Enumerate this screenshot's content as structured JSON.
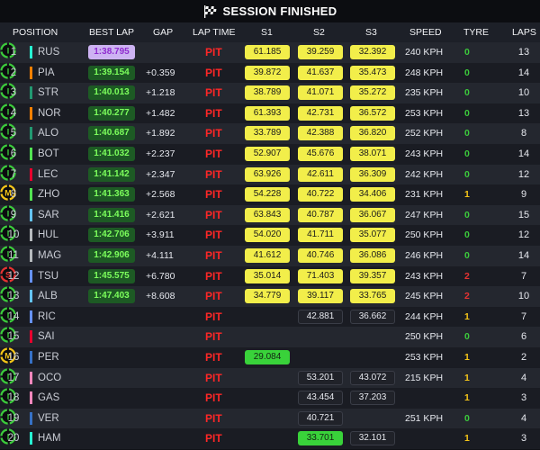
{
  "title": "SESSION FINISHED",
  "colors": {
    "purple_box": "#cdb3f2",
    "green_box": "#1d5a24",
    "sector_yellow": "#f2ee4a",
    "sector_green": "#39d23a",
    "pit_red": "#ff2727",
    "tyre_intermediate": "#3ccb3c",
    "tyre_medium": "#f5c518",
    "tyre_soft": "#e63232"
  },
  "headers": {
    "position": "POSITION",
    "best_lap": "BEST LAP",
    "gap": "GAP",
    "lap_time": "LAP TIME",
    "s1": "S1",
    "s2": "S2",
    "s3": "S3",
    "speed": "SPEED",
    "tyre": "TYRE",
    "laps": "LAPS"
  },
  "rows": [
    {
      "pos": "1",
      "driver": "RUS",
      "team_color": "#27f4d2",
      "best": "1:38.795",
      "best_style": "purple",
      "gap": "",
      "lap_time": "PIT",
      "s1": "61.185",
      "s1_style": "yellow",
      "s2": "39.259",
      "s2_style": "yellow",
      "s3": "32.392",
      "s3_style": "yellow",
      "speed": "240 KPH",
      "stint": "0",
      "tyre": "I",
      "tyre_color": "#3ccb3c",
      "laps": "13"
    },
    {
      "pos": "2",
      "driver": "PIA",
      "team_color": "#ff8000",
      "best": "1:39.154",
      "best_style": "green",
      "gap": "+0.359",
      "lap_time": "PIT",
      "s1": "39.872",
      "s1_style": "yellow",
      "s2": "41.637",
      "s2_style": "yellow",
      "s3": "35.473",
      "s3_style": "yellow",
      "speed": "248 KPH",
      "stint": "0",
      "tyre": "I",
      "tyre_color": "#3ccb3c",
      "laps": "14"
    },
    {
      "pos": "3",
      "driver": "STR",
      "team_color": "#229971",
      "best": "1:40.013",
      "best_style": "green",
      "gap": "+1.218",
      "lap_time": "PIT",
      "s1": "38.789",
      "s1_style": "yellow",
      "s2": "41.071",
      "s2_style": "yellow",
      "s3": "35.272",
      "s3_style": "yellow",
      "speed": "235 KPH",
      "stint": "0",
      "tyre": "I",
      "tyre_color": "#3ccb3c",
      "laps": "10"
    },
    {
      "pos": "4",
      "driver": "NOR",
      "team_color": "#ff8000",
      "best": "1:40.277",
      "best_style": "green",
      "gap": "+1.482",
      "lap_time": "PIT",
      "s1": "61.393",
      "s1_style": "yellow",
      "s2": "42.731",
      "s3": "36.572",
      "s2_style": "yellow",
      "s3_style": "yellow",
      "speed": "253 KPH",
      "stint": "0",
      "tyre": "I",
      "tyre_color": "#3ccb3c",
      "laps": "13"
    },
    {
      "pos": "5",
      "driver": "ALO",
      "team_color": "#229971",
      "best": "1:40.687",
      "best_style": "green",
      "gap": "+1.892",
      "lap_time": "PIT",
      "s1": "33.789",
      "s1_style": "yellow",
      "s2": "42.388",
      "s2_style": "yellow",
      "s3": "36.820",
      "s3_style": "yellow",
      "speed": "252 KPH",
      "stint": "0",
      "tyre": "I",
      "tyre_color": "#3ccb3c",
      "laps": "8"
    },
    {
      "pos": "6",
      "driver": "BOT",
      "team_color": "#52e252",
      "best": "1:41.032",
      "best_style": "green",
      "gap": "+2.237",
      "lap_time": "PIT",
      "s1": "52.907",
      "s1_style": "yellow",
      "s2": "45.676",
      "s2_style": "yellow",
      "s3": "38.071",
      "s3_style": "yellow",
      "speed": "243 KPH",
      "stint": "0",
      "tyre": "I",
      "tyre_color": "#3ccb3c",
      "laps": "14"
    },
    {
      "pos": "7",
      "driver": "LEC",
      "team_color": "#e8002d",
      "best": "1:41.142",
      "best_style": "green",
      "gap": "+2.347",
      "lap_time": "PIT",
      "s1": "63.926",
      "s1_style": "yellow",
      "s2": "42.611",
      "s2_style": "yellow",
      "s3": "36.309",
      "s3_style": "yellow",
      "speed": "242 KPH",
      "stint": "0",
      "tyre": "I",
      "tyre_color": "#3ccb3c",
      "laps": "12"
    },
    {
      "pos": "8",
      "driver": "ZHO",
      "team_color": "#52e252",
      "best": "1:41.363",
      "best_style": "green",
      "gap": "+2.568",
      "lap_time": "PIT",
      "s1": "54.228",
      "s1_style": "yellow",
      "s2": "40.722",
      "s2_style": "yellow",
      "s3": "34.406",
      "s3_style": "yellow",
      "speed": "231 KPH",
      "stint": "1",
      "tyre": "M",
      "tyre_color": "#f5c518",
      "laps": "9"
    },
    {
      "pos": "9",
      "driver": "SAR",
      "team_color": "#64c4ff",
      "best": "1:41.416",
      "best_style": "green",
      "gap": "+2.621",
      "lap_time": "PIT",
      "s1": "63.843",
      "s1_style": "yellow",
      "s2": "40.787",
      "s2_style": "yellow",
      "s3": "36.067",
      "s3_style": "yellow",
      "speed": "247 KPH",
      "stint": "0",
      "tyre": "I",
      "tyre_color": "#3ccb3c",
      "laps": "15"
    },
    {
      "pos": "10",
      "driver": "HUL",
      "team_color": "#b6babd",
      "best": "1:42.706",
      "best_style": "green",
      "gap": "+3.911",
      "lap_time": "PIT",
      "s1": "54.020",
      "s1_style": "yellow",
      "s2": "41.711",
      "s2_style": "yellow",
      "s3": "35.077",
      "s3_style": "yellow",
      "speed": "250 KPH",
      "stint": "0",
      "tyre": "I",
      "tyre_color": "#3ccb3c",
      "laps": "12"
    },
    {
      "pos": "11",
      "driver": "MAG",
      "team_color": "#b6babd",
      "best": "1:42.906",
      "best_style": "green",
      "gap": "+4.111",
      "lap_time": "PIT",
      "s1": "41.612",
      "s1_style": "yellow",
      "s2": "40.746",
      "s2_style": "yellow",
      "s3": "36.086",
      "s3_style": "yellow",
      "speed": "246 KPH",
      "stint": "0",
      "tyre": "I",
      "tyre_color": "#3ccb3c",
      "laps": "14"
    },
    {
      "pos": "12",
      "driver": "TSU",
      "team_color": "#6692ff",
      "best": "1:45.575",
      "best_style": "green",
      "gap": "+6.780",
      "lap_time": "PIT",
      "s1": "35.014",
      "s1_style": "yellow",
      "s2": "71.403",
      "s2_style": "yellow",
      "s3": "39.357",
      "s3_style": "yellow",
      "speed": "243 KPH",
      "stint": "2",
      "tyre": "S",
      "tyre_color": "#e63232",
      "laps": "7"
    },
    {
      "pos": "13",
      "driver": "ALB",
      "team_color": "#64c4ff",
      "best": "1:47.403",
      "best_style": "green",
      "gap": "+8.608",
      "lap_time": "PIT",
      "s1": "34.779",
      "s1_style": "yellow",
      "s2": "39.117",
      "s2_style": "yellow",
      "s3": "33.765",
      "s3_style": "yellow",
      "speed": "245 KPH",
      "stint": "2",
      "tyre": "I",
      "tyre_color": "#3ccb3c",
      "laps": "10"
    },
    {
      "pos": "14",
      "driver": "RIC",
      "team_color": "#6692ff",
      "best": "",
      "best_style": "",
      "gap": "",
      "lap_time": "PIT",
      "s1": "",
      "s1_style": "",
      "s2": "42.881",
      "s2_style": "plain",
      "s3": "36.662",
      "s3_style": "plain",
      "speed": "244 KPH",
      "stint": "1",
      "tyre": "I",
      "tyre_color": "#3ccb3c",
      "laps": "7"
    },
    {
      "pos": "15",
      "driver": "SAI",
      "team_color": "#e8002d",
      "best": "",
      "best_style": "",
      "gap": "",
      "lap_time": "PIT",
      "s1": "",
      "s1_style": "",
      "s2": "",
      "s2_style": "",
      "s3": "",
      "s3_style": "",
      "speed": "250 KPH",
      "stint": "0",
      "tyre": "I",
      "tyre_color": "#3ccb3c",
      "laps": "6"
    },
    {
      "pos": "16",
      "driver": "PER",
      "team_color": "#3671c6",
      "best": "",
      "best_style": "",
      "gap": "",
      "lap_time": "PIT",
      "s1": "29.084",
      "s1_style": "green",
      "s2": "",
      "s2_style": "",
      "s3": "",
      "s3_style": "",
      "speed": "253 KPH",
      "stint": "1",
      "tyre": "M",
      "tyre_color": "#f5c518",
      "laps": "2"
    },
    {
      "pos": "17",
      "driver": "OCO",
      "team_color": "#ff87bc",
      "best": "",
      "best_style": "",
      "gap": "",
      "lap_time": "PIT",
      "s1": "",
      "s1_style": "",
      "s2": "53.201",
      "s2_style": "plain",
      "s3": "43.072",
      "s3_style": "plain",
      "speed": "215 KPH",
      "stint": "1",
      "tyre": "I",
      "tyre_color": "#3ccb3c",
      "laps": "4"
    },
    {
      "pos": "18",
      "driver": "GAS",
      "team_color": "#ff87bc",
      "best": "",
      "best_style": "",
      "gap": "",
      "lap_time": "PIT",
      "s1": "",
      "s1_style": "",
      "s2": "43.454",
      "s2_style": "plain",
      "s3": "37.203",
      "s3_style": "plain",
      "speed": "",
      "stint": "1",
      "tyre": "I",
      "tyre_color": "#3ccb3c",
      "laps": "3"
    },
    {
      "pos": "19",
      "driver": "VER",
      "team_color": "#3671c6",
      "best": "",
      "best_style": "",
      "gap": "",
      "lap_time": "PIT",
      "s1": "",
      "s1_style": "",
      "s2": "40.721",
      "s2_style": "plain",
      "s3": "",
      "s3_style": "",
      "speed": "251 KPH",
      "stint": "0",
      "tyre": "I",
      "tyre_color": "#3ccb3c",
      "laps": "4"
    },
    {
      "pos": "20",
      "driver": "HAM",
      "team_color": "#27f4d2",
      "best": "",
      "best_style": "",
      "gap": "",
      "lap_time": "PIT",
      "s1": "",
      "s1_style": "",
      "s2": "33.701",
      "s2_style": "green",
      "s3": "32.101",
      "s3_style": "plain",
      "speed": "",
      "stint": "1",
      "tyre": "I",
      "tyre_color": "#3ccb3c",
      "laps": "3"
    }
  ]
}
